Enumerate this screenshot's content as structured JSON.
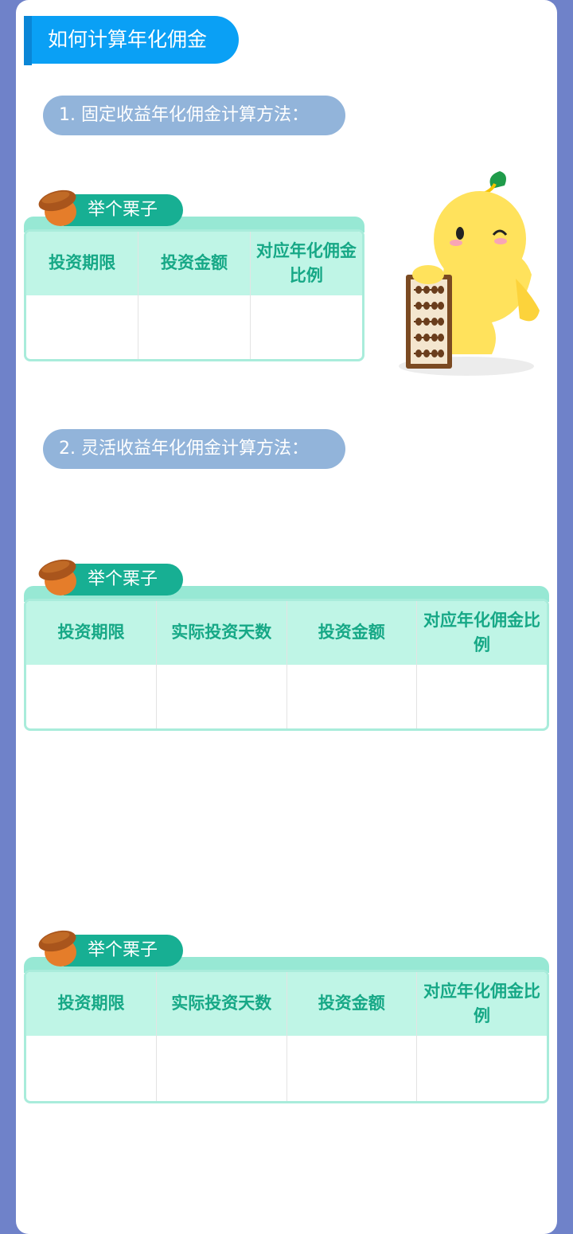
{
  "page_title": "如何计算年化佣金",
  "sections": [
    {
      "label": "1. 固定收益年化佣金计算方法："
    },
    {
      "label": "2. 灵活收益年化佣金计算方法："
    }
  ],
  "example_tag": "举个栗子",
  "tables": [
    {
      "headers": [
        "投资期限",
        "投资金额",
        "对应年化佣金比例"
      ]
    },
    {
      "headers": [
        "投资期限",
        "实际投资天数",
        "投资金额",
        "对应年化佣金比例"
      ]
    },
    {
      "headers": [
        "投资期限",
        "实际投资天数",
        "投资金额",
        "对应年化佣金比例"
      ]
    }
  ],
  "colors": {
    "background": "#6f82c9",
    "title_banner": "#0aa0f5",
    "section_pill": "#92b4da",
    "tag": "#17af93",
    "table_header_bg": "#bff5e6",
    "table_header_text": "#16a886"
  },
  "icons": [
    "acorn-icon",
    "mascot-abacus-illustration"
  ]
}
